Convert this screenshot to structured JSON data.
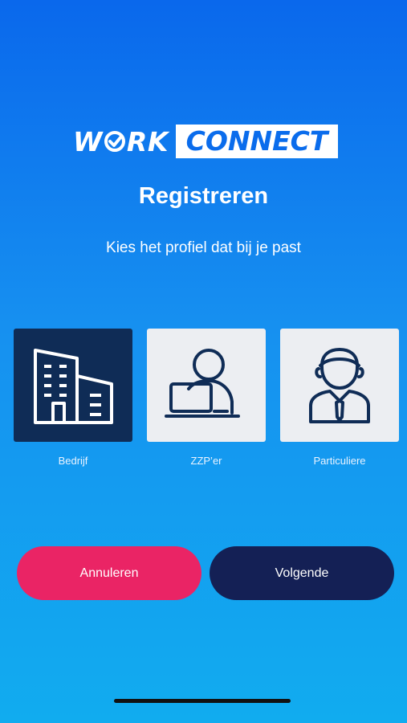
{
  "logo": {
    "work": "W",
    "work_rest": "RK",
    "connect": "CONNECT"
  },
  "title": "Registreren",
  "subtitle": "Kies het profiel dat bij je past",
  "profiles": [
    {
      "label": "Bedrijf",
      "icon": "building-icon",
      "selected": true
    },
    {
      "label": "ZZP’er",
      "icon": "freelancer-laptop-icon",
      "selected": false
    },
    {
      "label": "Particuliere",
      "icon": "person-tie-icon",
      "selected": false
    }
  ],
  "buttons": {
    "cancel": "Annuleren",
    "next": "Volgende"
  },
  "colors": {
    "cancel_button": "#ea2465",
    "next_button": "#142055",
    "selected_card": "#0f2c56",
    "card": "#eceef2"
  }
}
